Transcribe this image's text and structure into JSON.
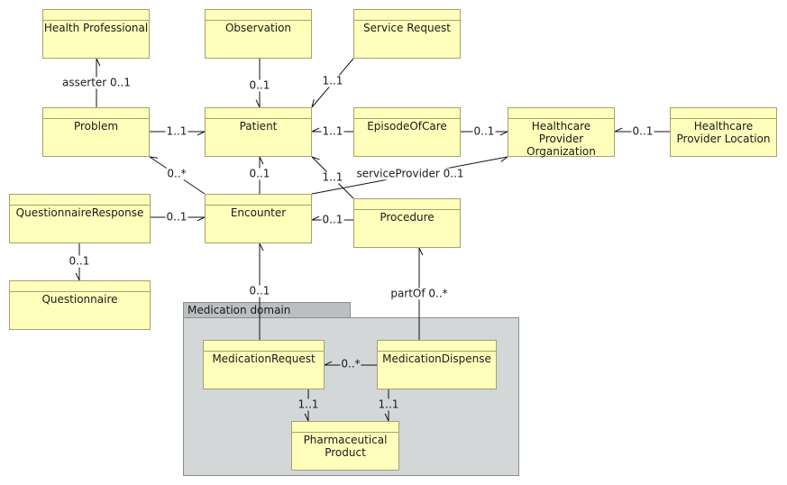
{
  "package": {
    "label": "Medication domain"
  },
  "classes": [
    {
      "id": "hp",
      "name": "Health Professional"
    },
    {
      "id": "obs",
      "name": "Observation"
    },
    {
      "id": "sr",
      "name": "Service Request"
    },
    {
      "id": "prob",
      "name": "Problem"
    },
    {
      "id": "pat",
      "name": "Patient"
    },
    {
      "id": "eoc",
      "name": "EpisodeOfCare"
    },
    {
      "id": "hpo",
      "name": "Healthcare Provider Organization"
    },
    {
      "id": "hpl",
      "name": "Healthcare Provider Location"
    },
    {
      "id": "qr",
      "name": "QuestionnaireResponse"
    },
    {
      "id": "enc",
      "name": "Encounter"
    },
    {
      "id": "proc",
      "name": "Procedure"
    },
    {
      "id": "q",
      "name": "Questionnaire"
    },
    {
      "id": "mr",
      "name": "MedicationRequest"
    },
    {
      "id": "md",
      "name": "MedicationDispense"
    },
    {
      "id": "pp",
      "name": "Pharmaceutical Product"
    }
  ],
  "associations": [
    {
      "from": "Problem",
      "to": "Health Professional",
      "label": "asserter 0..1"
    },
    {
      "from": "Observation",
      "to": "Patient",
      "label": "0..1"
    },
    {
      "from": "Service Request",
      "to": "Patient",
      "label": "1..1"
    },
    {
      "from": "Problem",
      "to": "Patient",
      "label": "1..1"
    },
    {
      "from": "EpisodeOfCare",
      "to": "Patient",
      "label": "1..1"
    },
    {
      "from": "EpisodeOfCare",
      "to": "Healthcare Provider Organization",
      "label": "0..1"
    },
    {
      "from": "Healthcare Provider Location",
      "to": "Healthcare Provider Organization",
      "label": "0..1"
    },
    {
      "from": "Encounter",
      "to": "Problem",
      "label": "0..*"
    },
    {
      "from": "Encounter",
      "to": "Patient",
      "label": "0..1"
    },
    {
      "from": "Procedure",
      "to": "Patient",
      "label": "1..1"
    },
    {
      "from": "Encounter",
      "to": "Healthcare Provider Organization",
      "label": "serviceProvider 0..1"
    },
    {
      "from": "QuestionnaireResponse",
      "to": "Encounter",
      "label": "0..1"
    },
    {
      "from": "Procedure",
      "to": "Encounter",
      "label": "0..1"
    },
    {
      "from": "QuestionnaireResponse",
      "to": "Questionnaire",
      "label": "0..1"
    },
    {
      "from": "MedicationRequest",
      "to": "Encounter",
      "label": "0..1"
    },
    {
      "from": "MedicationDispense",
      "to": "Procedure",
      "label": "partOf 0..*"
    },
    {
      "from": "MedicationDispense",
      "to": "MedicationRequest",
      "label": "0..*"
    },
    {
      "from": "MedicationRequest",
      "to": "Pharmaceutical Product",
      "label": "1..1"
    },
    {
      "from": "MedicationDispense",
      "to": "Pharmaceutical Product",
      "label": "1..1"
    }
  ]
}
